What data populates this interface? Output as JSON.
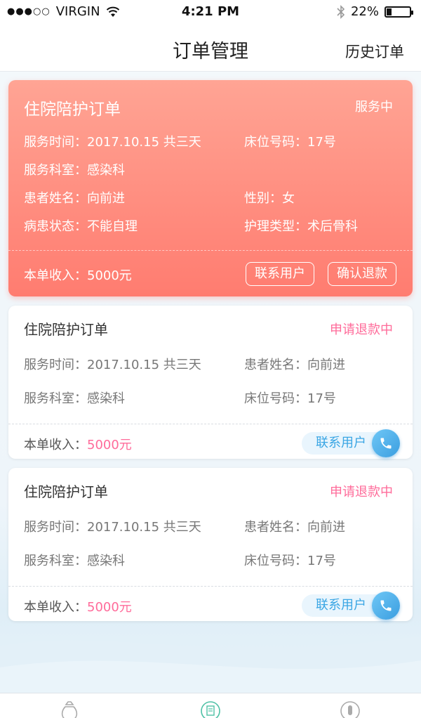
{
  "status_bar": {
    "carrier": "VIRGIN",
    "time": "4:21 PM",
    "battery": "22%",
    "battery_level": 0.22
  },
  "nav": {
    "title": "订单管理",
    "right_action": "历史订单"
  },
  "cards": [
    {
      "title": "住院陪护订单",
      "status": "服务中",
      "fields": {
        "service_time": {
          "label": "服务时间：",
          "value": "2017.10.15  共三天"
        },
        "bed_no": {
          "label": "床位号码：",
          "value": "17号"
        },
        "department": {
          "label": "服务科室：",
          "value": "感染科"
        },
        "patient_name": {
          "label": "患者姓名：",
          "value": "向前进"
        },
        "gender": {
          "label": "性别：",
          "value": "女"
        },
        "condition": {
          "label": "病患状态：",
          "value": "不能自理"
        },
        "care_type": {
          "label": "护理类型：",
          "value": "术后骨科"
        }
      },
      "income": {
        "label": "本单收入：",
        "value": "5000元"
      },
      "buttons": {
        "contact": "联系用户",
        "confirm_refund": "确认退款"
      }
    },
    {
      "title": "住院陪护订单",
      "status": "申请退款中",
      "fields": {
        "service_time": {
          "label": "服务时间：",
          "value": "2017.10.15  共三天"
        },
        "patient_name": {
          "label": "患者姓名：",
          "value": "向前进"
        },
        "department": {
          "label": "服务科室：",
          "value": "感染科"
        },
        "bed_no": {
          "label": "床位号码：",
          "value": "17号"
        }
      },
      "income": {
        "label": "本单收入：",
        "value": "5000元"
      },
      "contact": "联系用户"
    },
    {
      "title": "住院陪护订单",
      "status": "申请退款中",
      "fields": {
        "service_time": {
          "label": "服务时间：",
          "value": "2017.10.15  共三天"
        },
        "patient_name": {
          "label": "患者姓名：",
          "value": "向前进"
        },
        "department": {
          "label": "服务科室：",
          "value": "感染科"
        },
        "bed_no": {
          "label": "床位号码：",
          "value": "17号"
        }
      },
      "income": {
        "label": "本单收入：",
        "value": "5000元"
      },
      "contact": "联系用户"
    }
  ],
  "tab_bar": {
    "icons": [
      "money-bag-icon",
      "document-icon",
      "profile-icon"
    ]
  },
  "colors": {
    "active_card": "#ff8a7d",
    "status_pink": "#ff6b9a",
    "contact_blue": "#3aa6e4"
  }
}
